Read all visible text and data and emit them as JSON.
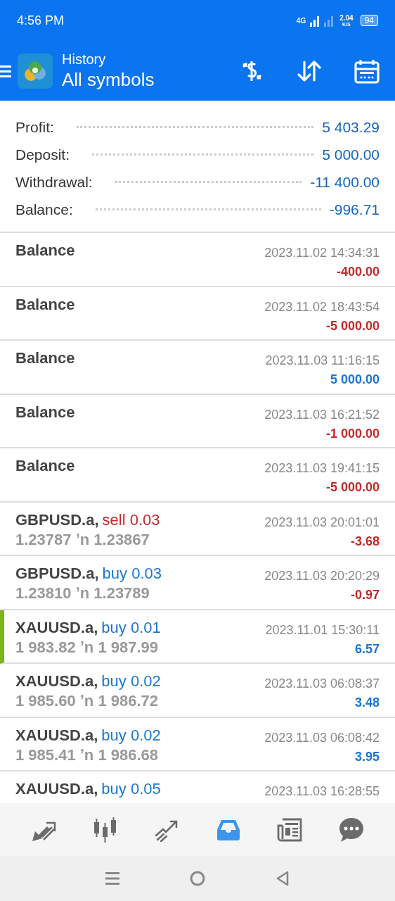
{
  "status_bar": {
    "time": "4:56 PM",
    "network": "4G",
    "speed": "2.04",
    "speed_unit": "K/S",
    "battery": "94"
  },
  "header": {
    "title": "History",
    "subtitle": "All symbols"
  },
  "summary": [
    {
      "label": "Profit:",
      "value": "5 403.29"
    },
    {
      "label": "Deposit:",
      "value": "5 000.00"
    },
    {
      "label": "Withdrawal:",
      "value": "-11 400.00"
    },
    {
      "label": "Balance:",
      "value": "-996.71"
    }
  ],
  "rows": [
    {
      "kind": "balance",
      "title": "Balance",
      "time": "2023.11.02 14:34:31",
      "amount": "-400.00",
      "negative": true,
      "marked": false
    },
    {
      "kind": "balance",
      "title": "Balance",
      "time": "2023.11.02 18:43:54",
      "amount": "-5 000.00",
      "negative": true,
      "marked": false
    },
    {
      "kind": "balance",
      "title": "Balance",
      "time": "2023.11.03 11:16:15",
      "amount": "5 000.00",
      "negative": false,
      "marked": false
    },
    {
      "kind": "balance",
      "title": "Balance",
      "time": "2023.11.03 16:21:52",
      "amount": "-1 000.00",
      "negative": true,
      "marked": false
    },
    {
      "kind": "balance",
      "title": "Balance",
      "time": "2023.11.03 19:41:15",
      "amount": "-5 000.00",
      "negative": true,
      "marked": false
    },
    {
      "kind": "trade",
      "symbol": "GBPUSD.a,",
      "order": "sell 0.03",
      "sell": true,
      "prices": "1.23787 ʼn 1.23867",
      "time": "2023.11.03 20:01:01",
      "amount": "-3.68",
      "negative": true,
      "marked": false
    },
    {
      "kind": "trade",
      "symbol": "GBPUSD.a,",
      "order": "buy 0.03",
      "sell": false,
      "prices": "1.23810 ʼn 1.23789",
      "time": "2023.11.03 20:20:29",
      "amount": "-0.97",
      "negative": true,
      "marked": false
    },
    {
      "kind": "trade",
      "symbol": "XAUUSD.a,",
      "order": "buy 0.01",
      "sell": false,
      "prices": "1 983.82 ʼn 1 987.99",
      "time": "2023.11.01 15:30:11",
      "amount": "6.57",
      "negative": false,
      "marked": true
    },
    {
      "kind": "trade",
      "symbol": "XAUUSD.a,",
      "order": "buy 0.02",
      "sell": false,
      "prices": "1 985.60 ʼn 1 986.72",
      "time": "2023.11.03 06:08:37",
      "amount": "3.48",
      "negative": false,
      "marked": false
    },
    {
      "kind": "trade",
      "symbol": "XAUUSD.a,",
      "order": "buy 0.02",
      "sell": false,
      "prices": "1 985.41 ʼn 1 986.68",
      "time": "2023.11.03 06:08:42",
      "amount": "3.95",
      "negative": false,
      "marked": false
    },
    {
      "kind": "trade",
      "symbol": "XAUUSD.a,",
      "order": "buy 0.05",
      "sell": false,
      "time": "2023.11.03 16:28:55",
      "marked": false
    }
  ],
  "bottom_nav": [
    {
      "kind": "quotes",
      "selected": false
    },
    {
      "kind": "chart",
      "selected": false
    },
    {
      "kind": "trade",
      "selected": false
    },
    {
      "kind": "history",
      "selected": true
    },
    {
      "kind": "news",
      "selected": false
    },
    {
      "kind": "chat",
      "selected": false
    }
  ]
}
